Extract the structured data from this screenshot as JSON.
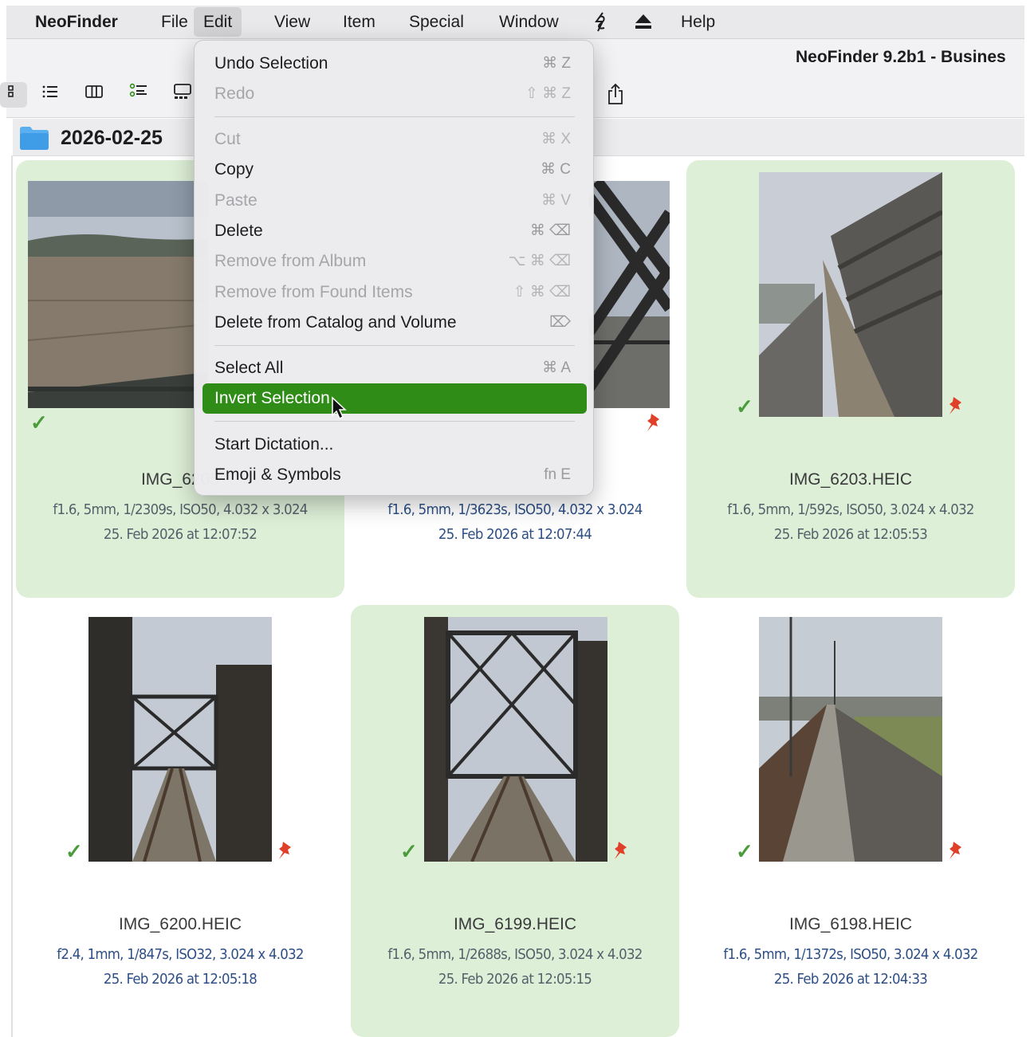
{
  "menubar": {
    "app": "NeoFinder",
    "items": [
      "File",
      "Edit",
      "View",
      "Item",
      "Special",
      "Window"
    ],
    "help": "Help",
    "open_menu": "Edit"
  },
  "window": {
    "title": "NeoFinder 9.2b1 - Busines"
  },
  "toolbar": {
    "view_modes": [
      "icon-view",
      "list-view",
      "column-view",
      "outline-view",
      "gallery-view"
    ],
    "share_icon": "share-icon"
  },
  "pathbar": {
    "folder": "2026-02-25"
  },
  "edit_menu": {
    "items": [
      {
        "label": "Undo Selection",
        "shortcut": "⌘ Z",
        "enabled": true
      },
      {
        "label": "Redo",
        "shortcut": "⇧ ⌘ Z",
        "enabled": false
      },
      {
        "label": "Cut",
        "shortcut": "⌘ X",
        "enabled": false
      },
      {
        "label": "Copy",
        "shortcut": "⌘ C",
        "enabled": true
      },
      {
        "label": "Paste",
        "shortcut": "⌘ V",
        "enabled": false
      },
      {
        "label": "Delete",
        "shortcut": "⌘ ⌫",
        "enabled": true
      },
      {
        "label": "Remove from Album",
        "shortcut": "⌥ ⌘ ⌫",
        "enabled": false
      },
      {
        "label": "Remove from Found Items",
        "shortcut": "⇧ ⌘ ⌫",
        "enabled": false
      },
      {
        "label": "Delete from Catalog and Volume",
        "shortcut": "⌦",
        "enabled": true
      },
      {
        "label": "Select All",
        "shortcut": "⌘ A",
        "enabled": true
      },
      {
        "label": "Invert Selection",
        "shortcut": "",
        "enabled": true,
        "highlighted": true
      },
      {
        "label": "Start Dictation...",
        "shortcut": "",
        "enabled": true
      },
      {
        "label": "Emoji & Symbols",
        "shortcut": "fn E",
        "enabled": true
      }
    ]
  },
  "photos": [
    {
      "name": "IMG_6205",
      "meta": "f1.6, 5mm, 1/2309s, ISO50, 4.032 x 3.024",
      "date": "25. Feb 2026 at 12:07:52",
      "selected": true,
      "checked": true,
      "pinned": false
    },
    {
      "name": "",
      "meta": "f1.6, 5mm, 1/3623s, ISO50, 4.032 x 3.024",
      "date": "25. Feb 2026 at 12:07:44",
      "selected": false,
      "checked": false,
      "pinned": true
    },
    {
      "name": "IMG_6203.HEIC",
      "meta": "f1.6, 5mm, 1/592s, ISO50, 3.024 x 4.032",
      "date": "25. Feb 2026 at 12:05:53",
      "selected": true,
      "checked": true,
      "pinned": true
    },
    {
      "name": "IMG_6200.HEIC",
      "meta": "f2.4, 1mm, 1/847s, ISO32, 3.024 x 4.032",
      "date": "25. Feb 2026 at 12:05:18",
      "selected": false,
      "checked": true,
      "pinned": true
    },
    {
      "name": "IMG_6199.HEIC",
      "meta": "f1.6, 5mm, 1/2688s, ISO50, 3.024 x 4.032",
      "date": "25. Feb 2026 at 12:05:15",
      "selected": true,
      "checked": true,
      "pinned": true
    },
    {
      "name": "IMG_6198.HEIC",
      "meta": "f1.6, 5mm, 1/1372s, ISO50, 3.024 x 4.032",
      "date": "25. Feb 2026 at 12:04:33",
      "selected": false,
      "checked": true,
      "pinned": true
    }
  ],
  "colors": {
    "selection_bg": "#ddefd7",
    "menu_highlight": "#2f8d17",
    "check": "#4a9c3a",
    "pin": "#e0402a",
    "meta_blue": "#2d4f86"
  }
}
